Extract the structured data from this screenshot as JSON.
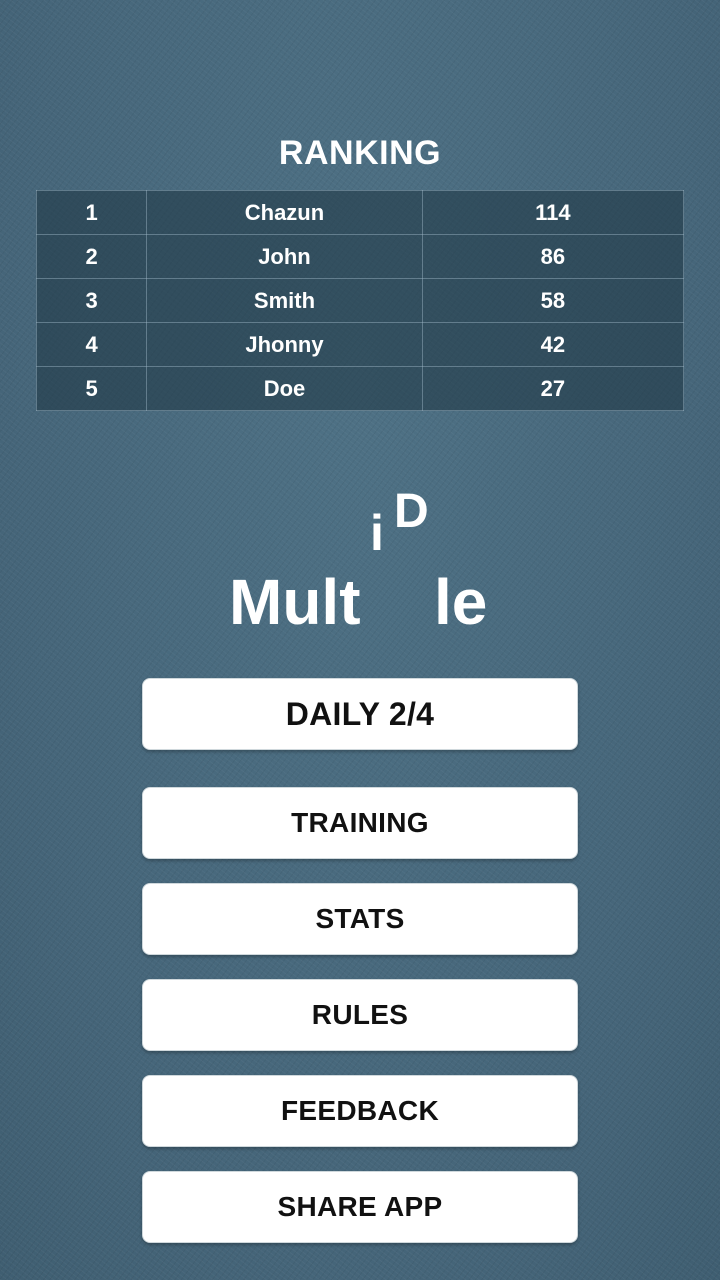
{
  "ranking": {
    "title": "RANKING",
    "rows": [
      {
        "rank": "1",
        "name": "Chazun",
        "score": "114"
      },
      {
        "rank": "2",
        "name": "John",
        "score": "86"
      },
      {
        "rank": "3",
        "name": "Smith",
        "score": "58"
      },
      {
        "rank": "4",
        "name": "Jhonny",
        "score": "42"
      },
      {
        "rank": "5",
        "name": "Doe",
        "score": "27"
      }
    ]
  },
  "logo": {
    "part1": "Mult",
    "part2": "i",
    "part3": "D",
    "part4": "le"
  },
  "menu": {
    "daily": "DAILY 2/4",
    "training": "TRAINING",
    "stats": "STATS",
    "rules": "RULES",
    "feedback": "FEEDBACK",
    "share": "SHARE APP"
  },
  "colors": {
    "background": "#48697d",
    "button": "#ffffff",
    "text_light": "#ffffff",
    "text_dark": "#111111"
  }
}
